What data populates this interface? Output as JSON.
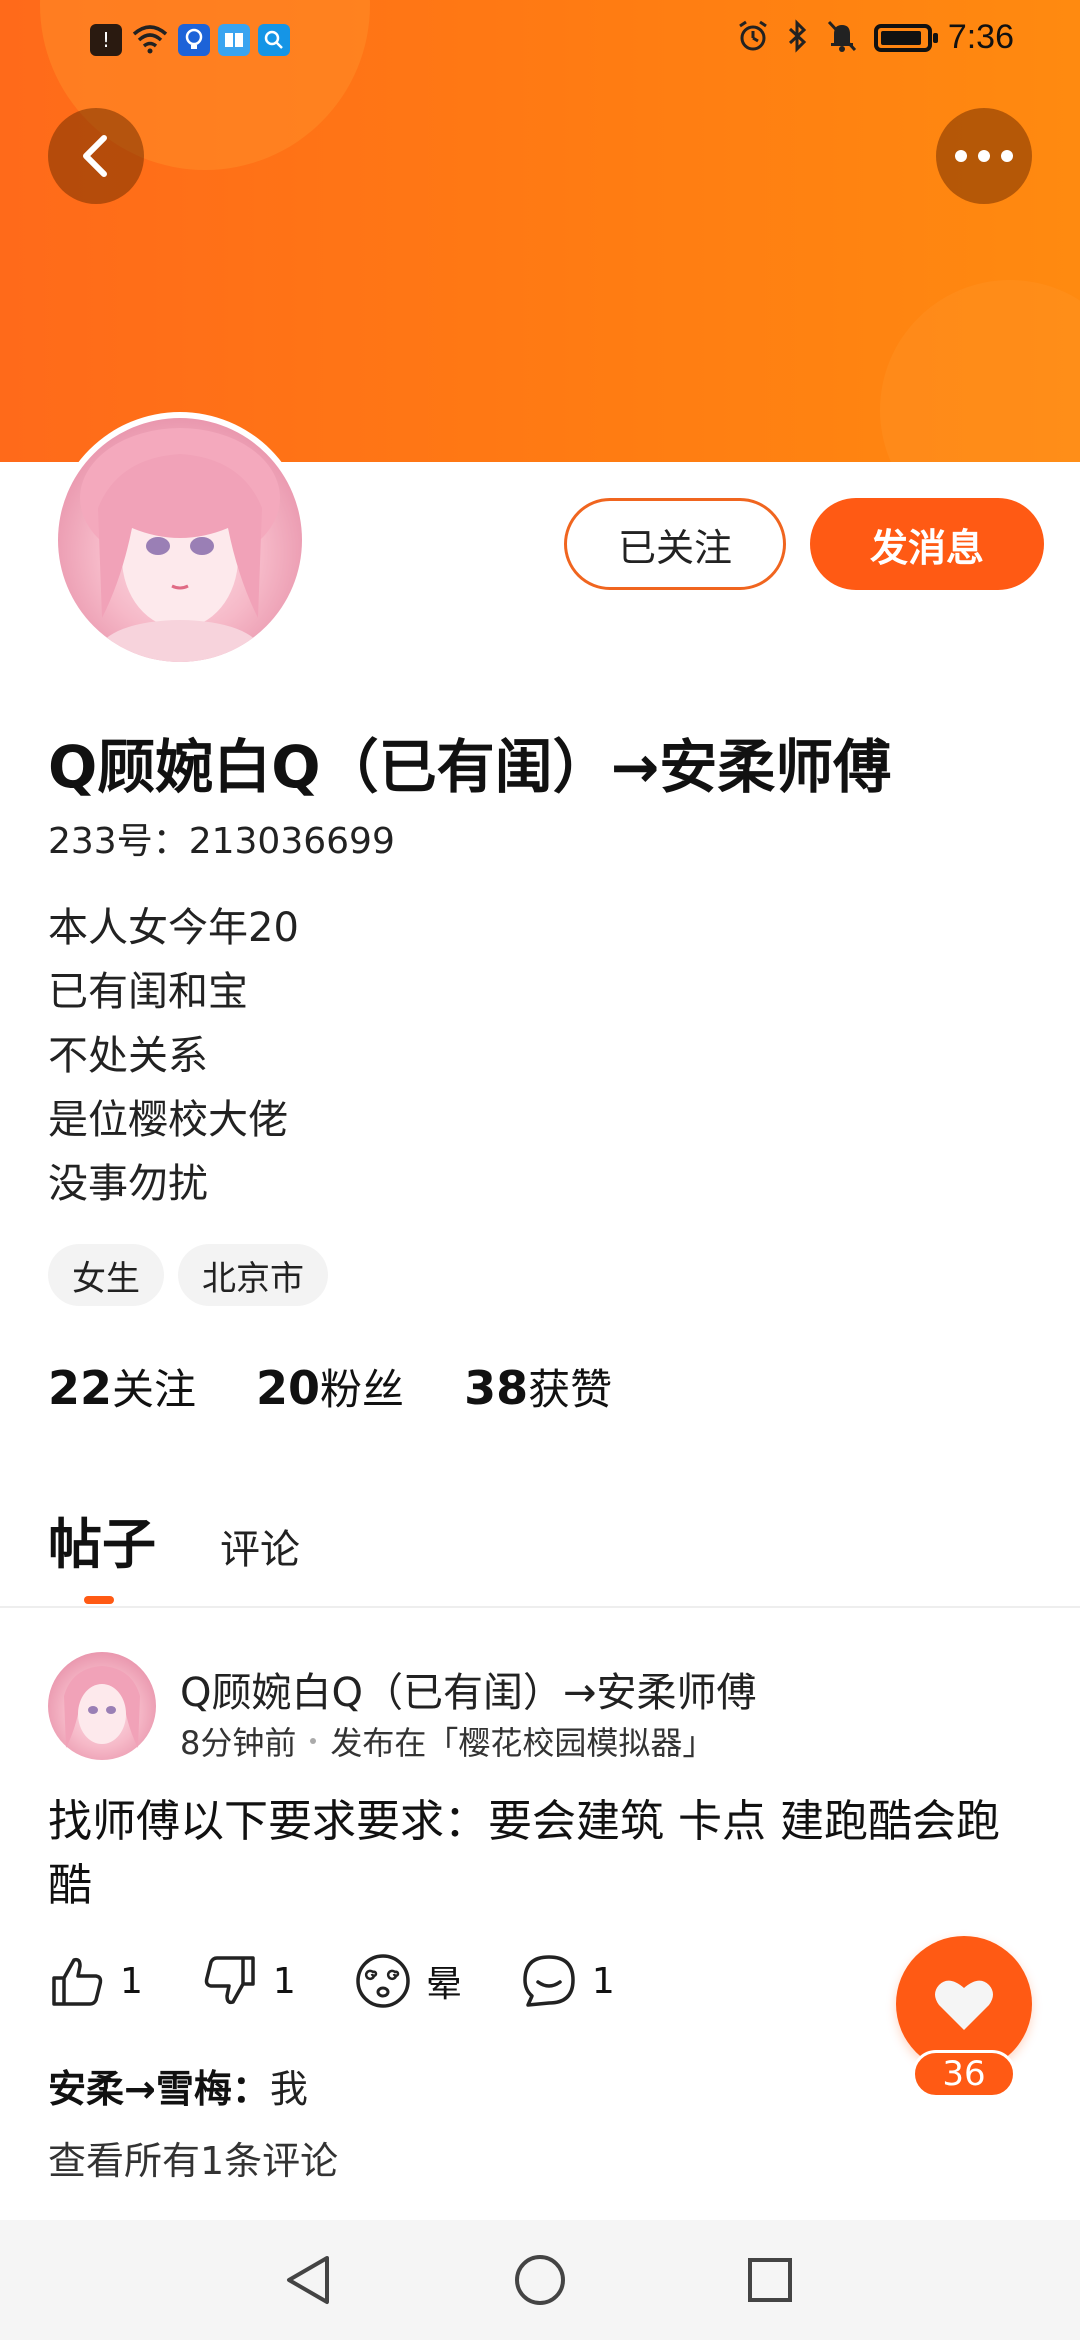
{
  "status_bar": {
    "time": "7:36",
    "left_icons": [
      "alert-icon",
      "wifi-icon",
      "bulb-icon",
      "book-icon",
      "search-app-icon"
    ],
    "right_icons": [
      "alarm-icon",
      "bluetooth-icon",
      "mute-icon",
      "battery-icon"
    ]
  },
  "header": {
    "back_icon": "chevron-left-icon",
    "more_icon": "more-dots-icon"
  },
  "profile": {
    "follow_label": "已关注",
    "message_label": "发消息",
    "username": "Q顾婉白Q（已有闺）→安柔师傅",
    "uid": "233号：213036699",
    "bio": [
      "本人女今年20",
      "已有闺和宝",
      "不处关系",
      "是位樱校大佬",
      "没事勿扰"
    ],
    "tags": [
      "女生",
      "北京市"
    ],
    "stats": [
      {
        "value": "22",
        "label": "关注"
      },
      {
        "value": "20",
        "label": "粉丝"
      },
      {
        "value": "38",
        "label": "获赞"
      }
    ]
  },
  "tabs": {
    "active": "帖子",
    "other": "评论"
  },
  "post": {
    "author": "Q顾婉白Q（已有闺）→安柔师傅",
    "time": "8分钟前",
    "published_in": "发布在「樱花校园模拟器」",
    "body": "找师傅以下要求要求：要会建筑 卡点 建跑酷会跑酷",
    "likes": "1",
    "dislikes": "1",
    "dizzy_label": "晕",
    "comments": "1",
    "comment_author": "安柔→雪梅：",
    "comment_text": "我",
    "view_all": "查看所有1条评论"
  },
  "fab": {
    "count": "36",
    "accent": "#ff5a14"
  },
  "colors": {
    "banner_start": "#ff6a1a",
    "banner_end": "#ff8a10",
    "accent": "#ff5a14"
  }
}
